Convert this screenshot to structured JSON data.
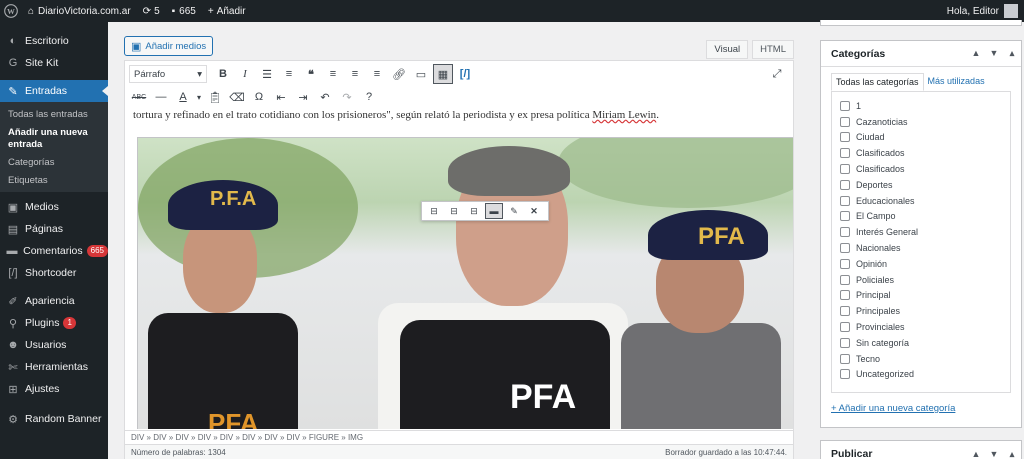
{
  "adminbar": {
    "site_name": "DiarioVictoria.com.ar",
    "updates_count": "5",
    "comments_count": "665",
    "new_label": "Añadir",
    "greeting": "Hola, Editor"
  },
  "sidebar": {
    "items": [
      {
        "label": "Escritorio",
        "icon": "dashboard-icon"
      },
      {
        "label": "Site Kit",
        "icon": "site-kit-icon"
      },
      {
        "label": "Entradas",
        "icon": "pin-icon"
      },
      {
        "label": "Medios",
        "icon": "media-icon"
      },
      {
        "label": "Páginas",
        "icon": "pages-icon"
      },
      {
        "label": "Comentarios",
        "icon": "comments-icon",
        "badge": "665"
      },
      {
        "label": "Shortcoder",
        "icon": "shortcode-icon"
      },
      {
        "label": "Apariencia",
        "icon": "brush-icon"
      },
      {
        "label": "Plugins",
        "icon": "plugin-icon",
        "badge": "1"
      },
      {
        "label": "Usuarios",
        "icon": "users-icon"
      },
      {
        "label": "Herramientas",
        "icon": "tools-icon"
      },
      {
        "label": "Ajustes",
        "icon": "settings-icon"
      },
      {
        "label": "Random Banner",
        "icon": "gear-icon"
      }
    ],
    "submenu": [
      {
        "label": "Todas las entradas"
      },
      {
        "label": "Añadir una nueva entrada"
      },
      {
        "label": "Categorías"
      },
      {
        "label": "Etiquetas"
      }
    ]
  },
  "editor": {
    "add_media_label": "Añadir medios",
    "tab_visual": "Visual",
    "tab_html": "HTML",
    "format_select": "Párrafo",
    "paragraph_text_a": "tortura y refinado en el trato cotidiano con los prisioneros\", según relató la periodista y ex presa política ",
    "paragraph_text_b": "Miriam Lewin",
    "paragraph_text_c": ".",
    "photo": {
      "vest_text": "PFA",
      "cap_text_1": "P.F.A",
      "cap_text_2": "PFA",
      "vest_partial": "PFA"
    },
    "path": "DIV » DIV » DIV » DIV » DIV » DIV » DIV » DIV » FIGURE » IMG",
    "word_count": "Número de palabras: 1304",
    "draft_saved": "Borrador guardado a las 10:47:44."
  },
  "categories": {
    "title": "Categorías",
    "tab_all": "Todas las categorías",
    "tab_popular": "Más utilizadas",
    "items": [
      "1",
      "Cazanoticias",
      "Ciudad",
      "Clasificados",
      "Clasificados",
      "Deportes",
      "Educacionales",
      "El Campo",
      "Interés General",
      "Nacionales",
      "Opinión",
      "Policiales",
      "Principal",
      "Principales",
      "Provinciales",
      "Sin categoría",
      "Tecno",
      "Uncategorized"
    ],
    "add_new": "+ Añadir una nueva categoría"
  },
  "publish": {
    "title": "Publicar"
  },
  "colors": {
    "admin_dark": "#1d2327",
    "accent": "#2271b1",
    "badge": "#d63638"
  }
}
